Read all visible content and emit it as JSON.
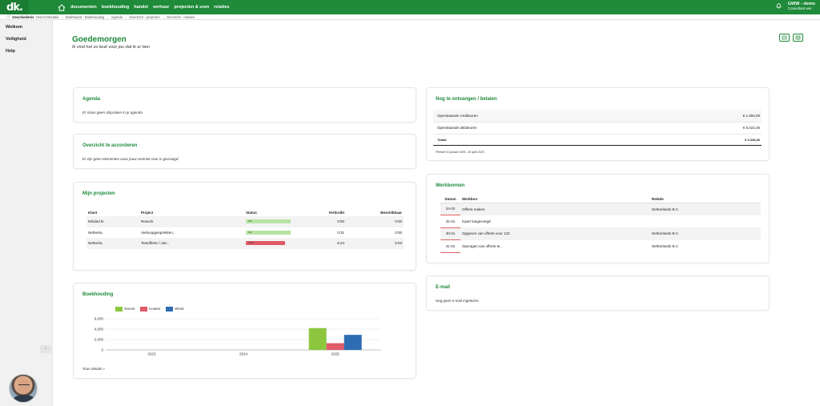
{
  "app": {
    "logo": "dk.",
    "nav": [
      "documenten",
      "boekhouding",
      "handel",
      "verhuur",
      "projecten & uren",
      "relaties"
    ],
    "user_name": "GWW - demo",
    "user_role": "Consultant wer.."
  },
  "breadcrumb": {
    "first": "Geschiedenis",
    "items": [
      "Overzichtrelatie",
      "Dashboard - Boekhouding",
      "Agenda",
      "Overzicht - projecten",
      "Overzicht - relaties"
    ],
    "separator": "→"
  },
  "sidebar": {
    "items": [
      "Welkom",
      "Veiligheid",
      "Help"
    ],
    "collapse": "‹"
  },
  "header": {
    "title": "Goedemorgen",
    "subtitle": "Ik vind het zo leuk voor jou dat ik er ben"
  },
  "agenda": {
    "title": "Agenda",
    "message": "Er staan geen afspraken in je agenda"
  },
  "accorderen": {
    "title": "Overzicht te accorderen",
    "message": "Er zijn geen elementen waar jouw controle voor is gevraagd."
  },
  "projecten": {
    "title": "Mijn projecten",
    "columns": [
      "Klant",
      "Project",
      "Status",
      "Verbruikt",
      "Beschikbaar"
    ],
    "rows": [
      {
        "klant": "Minded B..",
        "project": "Rework",
        "status_label": "0%",
        "status_pct": 100,
        "status_color": "#b7e4a4",
        "verbruikt": "0:00",
        "beschikbaar": "0:00"
      },
      {
        "klant": "Netherla..",
        "project": "Verkoopgesprekken..",
        "status_label": "0%",
        "status_pct": 100,
        "status_color": "#b7e4a4",
        "verbruikt": "0:31",
        "beschikbaar": "0:00"
      },
      {
        "klant": "Netherla..",
        "project": "Testofferte / calc..",
        "status_label": "126%",
        "status_pct": 88,
        "status_color": "#e05a67",
        "verbruikt": "6:24",
        "beschikbaar": "5:03"
      }
    ]
  },
  "boekhouding": {
    "title": "Boekhouding",
    "link": "Toon details »",
    "colors": {
      "omzet": "#8dc63f",
      "kosten": "#e05a67",
      "winst": "#2f6db3"
    }
  },
  "chart_data": {
    "type": "bar",
    "categories": [
      "2023",
      "2024",
      "2025"
    ],
    "series": [
      {
        "name": "Omzet",
        "values": [
          0,
          0,
          4200
        ]
      },
      {
        "name": "Kosten",
        "values": [
          0,
          0,
          1300
        ]
      },
      {
        "name": "Winst",
        "values": [
          0,
          0,
          2900
        ]
      }
    ],
    "yticks": [
      "6,000",
      "4,000",
      "2,000",
      "0"
    ],
    "ylim": [
      0,
      6000
    ],
    "grid": true,
    "legend": "top-left"
  },
  "ontvangen": {
    "title": "Nog te ontvangen / betalen",
    "rows": [
      {
        "label": "Openstaande crediteuren",
        "value": "€ 1.694,00"
      },
      {
        "label": "Openstaande debiteuren",
        "value": "€ 5.022,36"
      }
    ],
    "total_label": "Totaal",
    "total_value": "€ 3.328,36",
    "periode": "Periode 01 januari 2025 - 30 april 2025"
  },
  "werkbonnen": {
    "title": "Werkbonnen",
    "columns": [
      "Datum",
      "Werkbon",
      "Relatie"
    ],
    "rows": [
      {
        "datum": "24-02",
        "werkbon": "Offerte maken",
        "relatie": "Netherlands B.V."
      },
      {
        "datum": "31-01",
        "werkbon": "Kaart toegevoegd",
        "relatie": ""
      },
      {
        "datum": "30-01",
        "werkbon": "Opgeven van offerte voor 123",
        "relatie": "Netherlands B.V."
      },
      {
        "datum": "31-01",
        "werkbon": "Opvragen van offerte te..",
        "relatie": "Netherlands B.V."
      }
    ]
  },
  "email": {
    "title": "E-mail",
    "message": "Nog geen e-mail ingelezen."
  }
}
